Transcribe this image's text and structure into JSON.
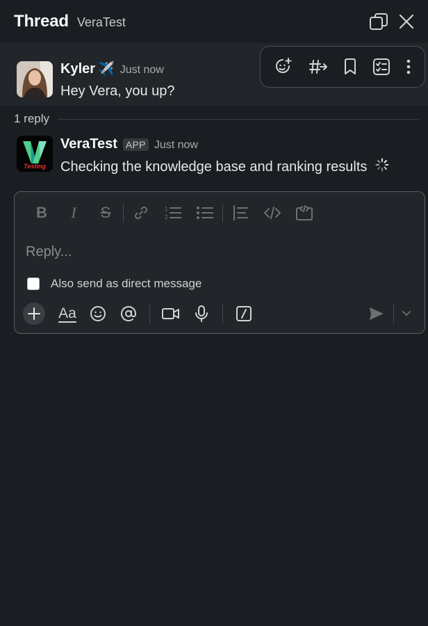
{
  "header": {
    "title": "Thread",
    "channel": "VeraTest",
    "icons": [
      "open-in-new-window-icon",
      "close-icon"
    ]
  },
  "parent_message": {
    "author": "Kyler",
    "author_emoji": "✈️",
    "time": "Just now",
    "text": "Hey Vera, you up?"
  },
  "hover_toolbar": {
    "icons": [
      "add-reaction-icon",
      "forward-to-channel-icon",
      "bookmark-icon",
      "add-to-list-icon",
      "more-actions-icon"
    ]
  },
  "replies": {
    "count_label": "1 reply"
  },
  "reply_message": {
    "author": "VeraTest",
    "badge": "APP",
    "time": "Just now",
    "text": "Checking the knowledge base and ranking results",
    "avatar_text": "Testing"
  },
  "composer": {
    "placeholder": "Reply...",
    "value": "",
    "format_icons": [
      "bold-icon",
      "italic-icon",
      "strikethrough-icon",
      "link-icon",
      "ordered-list-icon",
      "bulleted-list-icon",
      "blockquote-icon",
      "code-icon",
      "code-block-icon"
    ],
    "also_send_label": "Also send as direct message",
    "also_send_checked": false,
    "bottom_icons": [
      "plus-icon",
      "text-format-icon",
      "emoji-icon",
      "mention-icon",
      "video-icon",
      "microphone-icon",
      "slash-command-icon",
      "send-icon",
      "chevron-down-icon"
    ],
    "format_toggle_label": "Aa"
  },
  "colors": {
    "background": "#1a1d21",
    "highlight_row": "#222529",
    "text_primary": "#f8f8f8",
    "text_muted": "#ababad",
    "bot_logo_green": "#4fd08a",
    "bot_logo_red": "#e3342f"
  }
}
